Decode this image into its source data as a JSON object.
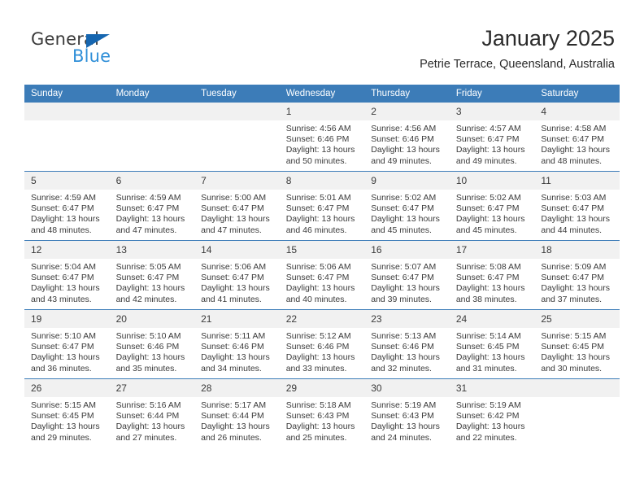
{
  "brand": {
    "name_top": "General",
    "name_bottom": "Blue",
    "accent_color": "#2f8fd8",
    "triangle_color": "#1666b0"
  },
  "header": {
    "title": "January 2025",
    "subtitle": "Petrie Terrace, Queensland, Australia",
    "header_bg_color": "#3c7cb8",
    "header_text_color": "#ffffff"
  },
  "calendar": {
    "weekday_headers": [
      "Sunday",
      "Monday",
      "Tuesday",
      "Wednesday",
      "Thursday",
      "Friday",
      "Saturday"
    ],
    "leading_blanks": 3,
    "weeks": [
      [
        {
          "day": "",
          "lines": []
        },
        {
          "day": "",
          "lines": []
        },
        {
          "day": "",
          "lines": []
        },
        {
          "day": "1",
          "lines": [
            "Sunrise: 4:56 AM",
            "Sunset: 6:46 PM",
            "Daylight: 13 hours",
            "and 50 minutes."
          ]
        },
        {
          "day": "2",
          "lines": [
            "Sunrise: 4:56 AM",
            "Sunset: 6:46 PM",
            "Daylight: 13 hours",
            "and 49 minutes."
          ]
        },
        {
          "day": "3",
          "lines": [
            "Sunrise: 4:57 AM",
            "Sunset: 6:47 PM",
            "Daylight: 13 hours",
            "and 49 minutes."
          ]
        },
        {
          "day": "4",
          "lines": [
            "Sunrise: 4:58 AM",
            "Sunset: 6:47 PM",
            "Daylight: 13 hours",
            "and 48 minutes."
          ]
        }
      ],
      [
        {
          "day": "5",
          "lines": [
            "Sunrise: 4:59 AM",
            "Sunset: 6:47 PM",
            "Daylight: 13 hours",
            "and 48 minutes."
          ]
        },
        {
          "day": "6",
          "lines": [
            "Sunrise: 4:59 AM",
            "Sunset: 6:47 PM",
            "Daylight: 13 hours",
            "and 47 minutes."
          ]
        },
        {
          "day": "7",
          "lines": [
            "Sunrise: 5:00 AM",
            "Sunset: 6:47 PM",
            "Daylight: 13 hours",
            "and 47 minutes."
          ]
        },
        {
          "day": "8",
          "lines": [
            "Sunrise: 5:01 AM",
            "Sunset: 6:47 PM",
            "Daylight: 13 hours",
            "and 46 minutes."
          ]
        },
        {
          "day": "9",
          "lines": [
            "Sunrise: 5:02 AM",
            "Sunset: 6:47 PM",
            "Daylight: 13 hours",
            "and 45 minutes."
          ]
        },
        {
          "day": "10",
          "lines": [
            "Sunrise: 5:02 AM",
            "Sunset: 6:47 PM",
            "Daylight: 13 hours",
            "and 45 minutes."
          ]
        },
        {
          "day": "11",
          "lines": [
            "Sunrise: 5:03 AM",
            "Sunset: 6:47 PM",
            "Daylight: 13 hours",
            "and 44 minutes."
          ]
        }
      ],
      [
        {
          "day": "12",
          "lines": [
            "Sunrise: 5:04 AM",
            "Sunset: 6:47 PM",
            "Daylight: 13 hours",
            "and 43 minutes."
          ]
        },
        {
          "day": "13",
          "lines": [
            "Sunrise: 5:05 AM",
            "Sunset: 6:47 PM",
            "Daylight: 13 hours",
            "and 42 minutes."
          ]
        },
        {
          "day": "14",
          "lines": [
            "Sunrise: 5:06 AM",
            "Sunset: 6:47 PM",
            "Daylight: 13 hours",
            "and 41 minutes."
          ]
        },
        {
          "day": "15",
          "lines": [
            "Sunrise: 5:06 AM",
            "Sunset: 6:47 PM",
            "Daylight: 13 hours",
            "and 40 minutes."
          ]
        },
        {
          "day": "16",
          "lines": [
            "Sunrise: 5:07 AM",
            "Sunset: 6:47 PM",
            "Daylight: 13 hours",
            "and 39 minutes."
          ]
        },
        {
          "day": "17",
          "lines": [
            "Sunrise: 5:08 AM",
            "Sunset: 6:47 PM",
            "Daylight: 13 hours",
            "and 38 minutes."
          ]
        },
        {
          "day": "18",
          "lines": [
            "Sunrise: 5:09 AM",
            "Sunset: 6:47 PM",
            "Daylight: 13 hours",
            "and 37 minutes."
          ]
        }
      ],
      [
        {
          "day": "19",
          "lines": [
            "Sunrise: 5:10 AM",
            "Sunset: 6:47 PM",
            "Daylight: 13 hours",
            "and 36 minutes."
          ]
        },
        {
          "day": "20",
          "lines": [
            "Sunrise: 5:10 AM",
            "Sunset: 6:46 PM",
            "Daylight: 13 hours",
            "and 35 minutes."
          ]
        },
        {
          "day": "21",
          "lines": [
            "Sunrise: 5:11 AM",
            "Sunset: 6:46 PM",
            "Daylight: 13 hours",
            "and 34 minutes."
          ]
        },
        {
          "day": "22",
          "lines": [
            "Sunrise: 5:12 AM",
            "Sunset: 6:46 PM",
            "Daylight: 13 hours",
            "and 33 minutes."
          ]
        },
        {
          "day": "23",
          "lines": [
            "Sunrise: 5:13 AM",
            "Sunset: 6:46 PM",
            "Daylight: 13 hours",
            "and 32 minutes."
          ]
        },
        {
          "day": "24",
          "lines": [
            "Sunrise: 5:14 AM",
            "Sunset: 6:45 PM",
            "Daylight: 13 hours",
            "and 31 minutes."
          ]
        },
        {
          "day": "25",
          "lines": [
            "Sunrise: 5:15 AM",
            "Sunset: 6:45 PM",
            "Daylight: 13 hours",
            "and 30 minutes."
          ]
        }
      ],
      [
        {
          "day": "26",
          "lines": [
            "Sunrise: 5:15 AM",
            "Sunset: 6:45 PM",
            "Daylight: 13 hours",
            "and 29 minutes."
          ]
        },
        {
          "day": "27",
          "lines": [
            "Sunrise: 5:16 AM",
            "Sunset: 6:44 PM",
            "Daylight: 13 hours",
            "and 27 minutes."
          ]
        },
        {
          "day": "28",
          "lines": [
            "Sunrise: 5:17 AM",
            "Sunset: 6:44 PM",
            "Daylight: 13 hours",
            "and 26 minutes."
          ]
        },
        {
          "day": "29",
          "lines": [
            "Sunrise: 5:18 AM",
            "Sunset: 6:43 PM",
            "Daylight: 13 hours",
            "and 25 minutes."
          ]
        },
        {
          "day": "30",
          "lines": [
            "Sunrise: 5:19 AM",
            "Sunset: 6:43 PM",
            "Daylight: 13 hours",
            "and 24 minutes."
          ]
        },
        {
          "day": "31",
          "lines": [
            "Sunrise: 5:19 AM",
            "Sunset: 6:42 PM",
            "Daylight: 13 hours",
            "and 22 minutes."
          ]
        },
        {
          "day": "",
          "lines": []
        }
      ]
    ]
  }
}
